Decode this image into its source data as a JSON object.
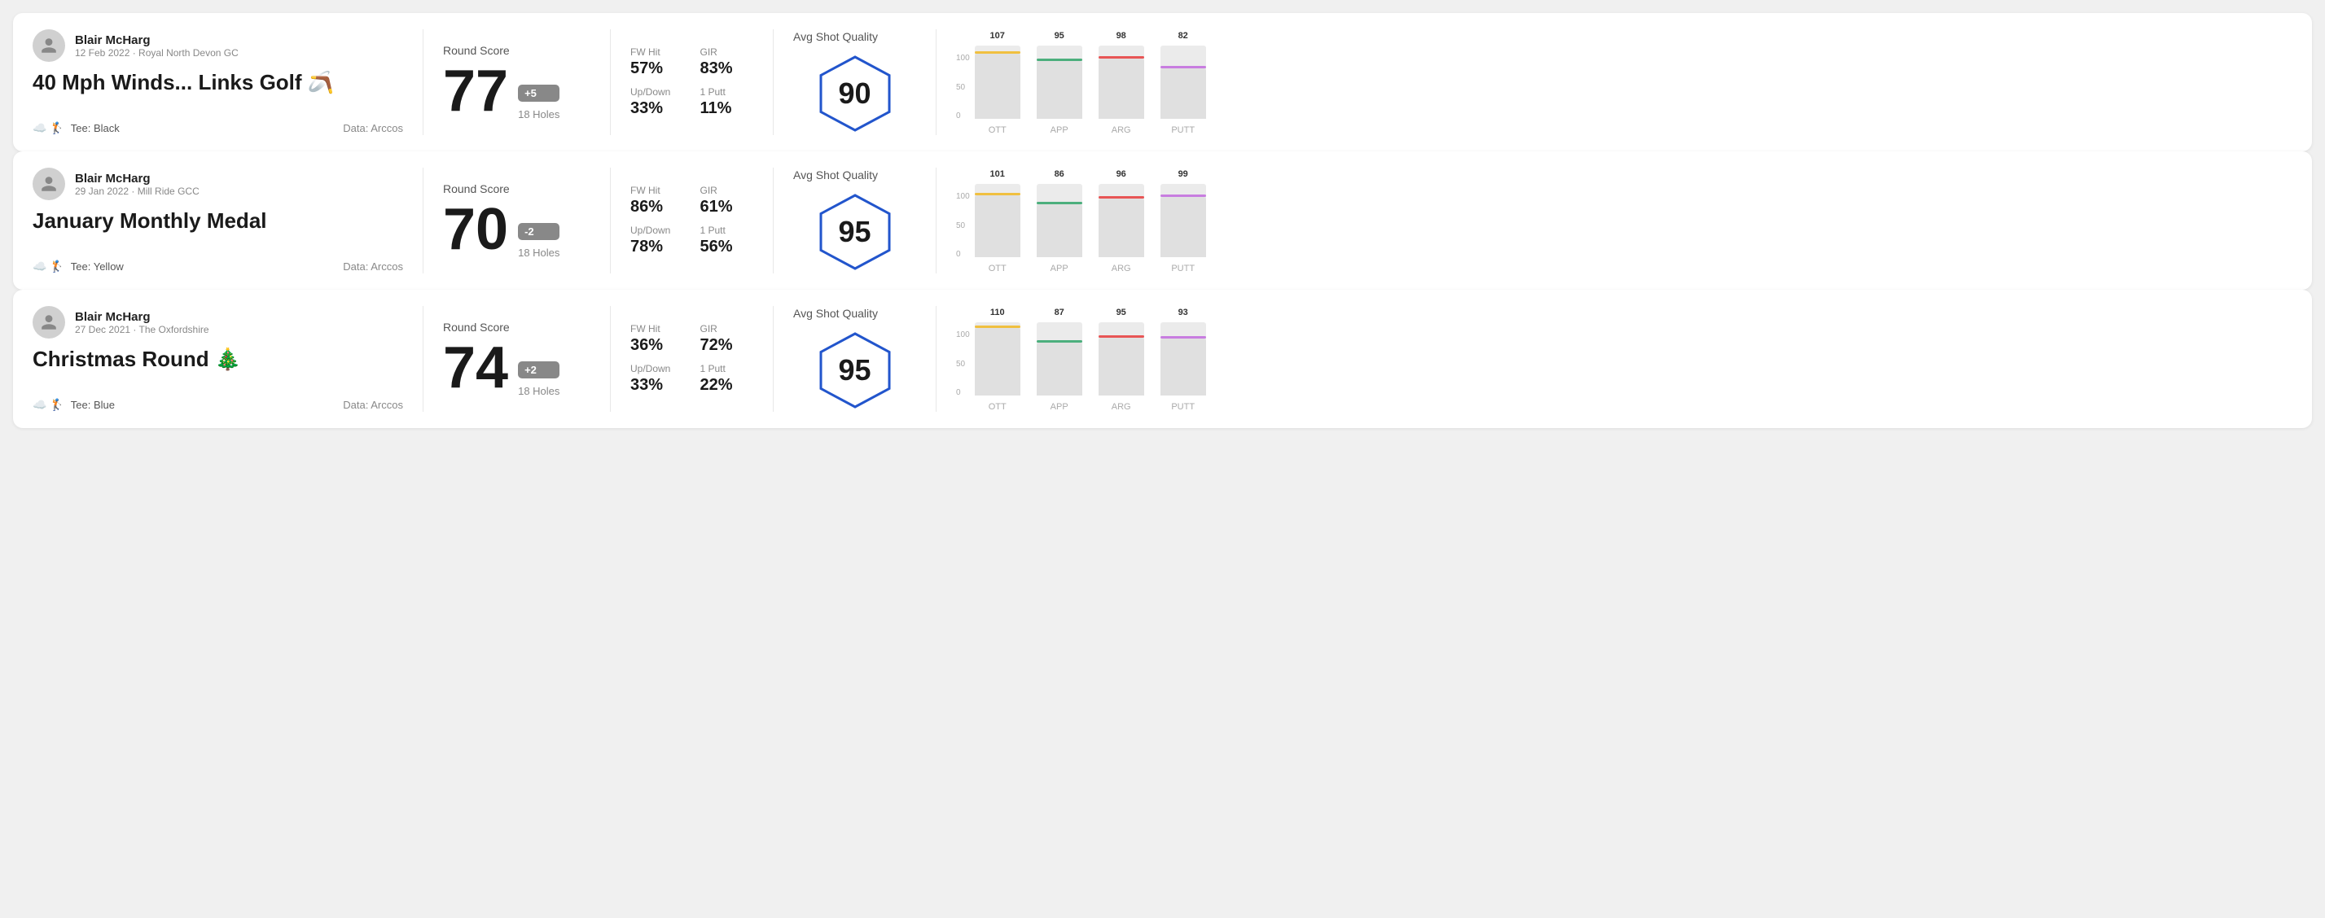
{
  "rounds": [
    {
      "id": "round1",
      "user_name": "Blair McHarg",
      "user_date": "12 Feb 2022 · Royal North Devon GC",
      "title": "40 Mph Winds... Links Golf 🪃",
      "tee": "Tee: Black",
      "data_source": "Data: Arccos",
      "score": "77",
      "score_diff": "+5",
      "score_diff_type": "plus",
      "holes": "18 Holes",
      "fw_hit": "57%",
      "gir": "83%",
      "up_down": "33%",
      "one_putt": "11%",
      "avg_quality_label": "Avg Shot Quality",
      "avg_quality_score": "90",
      "chart": {
        "bars": [
          {
            "label": "OTT",
            "value": 107,
            "color": "#f0c040",
            "max": 120
          },
          {
            "label": "APP",
            "value": 95,
            "color": "#4caf7d",
            "max": 120
          },
          {
            "label": "ARG",
            "value": 98,
            "color": "#e85555",
            "max": 120
          },
          {
            "label": "PUTT",
            "value": 82,
            "color": "#c87de0",
            "max": 120
          }
        ]
      }
    },
    {
      "id": "round2",
      "user_name": "Blair McHarg",
      "user_date": "29 Jan 2022 · Mill Ride GCC",
      "title": "January Monthly Medal",
      "tee": "Tee: Yellow",
      "data_source": "Data: Arccos",
      "score": "70",
      "score_diff": "-2",
      "score_diff_type": "minus",
      "holes": "18 Holes",
      "fw_hit": "86%",
      "gir": "61%",
      "up_down": "78%",
      "one_putt": "56%",
      "avg_quality_label": "Avg Shot Quality",
      "avg_quality_score": "95",
      "chart": {
        "bars": [
          {
            "label": "OTT",
            "value": 101,
            "color": "#f0c040",
            "max": 120
          },
          {
            "label": "APP",
            "value": 86,
            "color": "#4caf7d",
            "max": 120
          },
          {
            "label": "ARG",
            "value": 96,
            "color": "#e85555",
            "max": 120
          },
          {
            "label": "PUTT",
            "value": 99,
            "color": "#c87de0",
            "max": 120
          }
        ]
      }
    },
    {
      "id": "round3",
      "user_name": "Blair McHarg",
      "user_date": "27 Dec 2021 · The Oxfordshire",
      "title": "Christmas Round 🎄",
      "tee": "Tee: Blue",
      "data_source": "Data: Arccos",
      "score": "74",
      "score_diff": "+2",
      "score_diff_type": "plus",
      "holes": "18 Holes",
      "fw_hit": "36%",
      "gir": "72%",
      "up_down": "33%",
      "one_putt": "22%",
      "avg_quality_label": "Avg Shot Quality",
      "avg_quality_score": "95",
      "chart": {
        "bars": [
          {
            "label": "OTT",
            "value": 110,
            "color": "#f0c040",
            "max": 120
          },
          {
            "label": "APP",
            "value": 87,
            "color": "#4caf7d",
            "max": 120
          },
          {
            "label": "ARG",
            "value": 95,
            "color": "#e85555",
            "max": 120
          },
          {
            "label": "PUTT",
            "value": 93,
            "color": "#c87de0",
            "max": 120
          }
        ]
      }
    }
  ],
  "labels": {
    "round_score": "Round Score",
    "fw_hit": "FW Hit",
    "gir": "GIR",
    "up_down": "Up/Down",
    "one_putt": "1 Putt",
    "data_arccos": "Data: Arccos",
    "y_axis_100": "100",
    "y_axis_50": "50",
    "y_axis_0": "0"
  }
}
